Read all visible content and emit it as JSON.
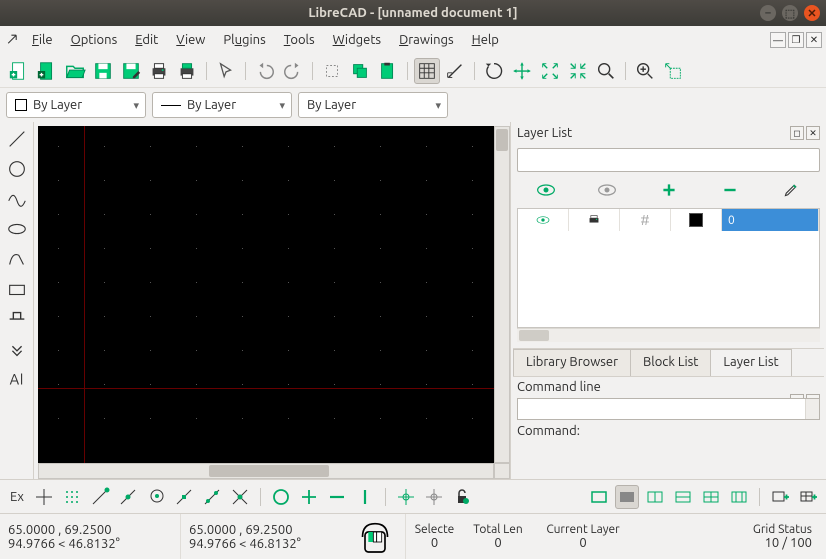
{
  "title": "LibreCAD - [unnamed document 1]",
  "menu": {
    "file": "File",
    "options": "Options",
    "edit": "Edit",
    "view": "View",
    "plugins": "Plugins",
    "tools": "Tools",
    "widgets": "Widgets",
    "drawings": "Drawings",
    "help": "Help"
  },
  "combos": {
    "color": "By Layer",
    "linewidth": "By Layer",
    "linetype": "By Layer"
  },
  "right": {
    "layer_list_title": "Layer List",
    "filter_placeholder": "",
    "layer_name": "0",
    "tabs": {
      "library": "Library Browser",
      "blocks": "Block List",
      "layers": "Layer List"
    },
    "cmd_title": "Command line",
    "cmd_prompt": "Command:"
  },
  "bottom": {
    "ex": "Ex"
  },
  "status": {
    "abs_coord": "65.0000 , 69.2500",
    "polar_coord": "94.9766 < 46.8132°",
    "rel_coord": "65.0000 , 69.2500",
    "rel_polar": "94.9766 < 46.8132°",
    "selected_h": "Selecte",
    "selected_v": "0",
    "total_h": "Total Len",
    "total_v": "0",
    "layer_h": "Current Layer",
    "layer_v": "0",
    "grid_h": "Grid Status",
    "grid_v": "10 / 100"
  }
}
